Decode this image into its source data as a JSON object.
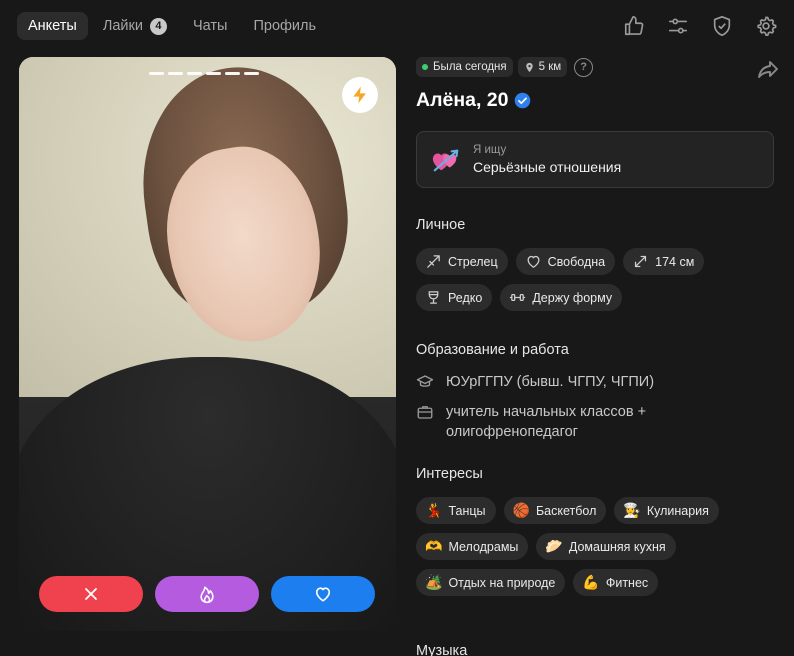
{
  "nav": {
    "tabs": [
      {
        "label": "Анкеты",
        "active": true
      },
      {
        "label": "Лайки",
        "badge": "4"
      },
      {
        "label": "Чаты"
      },
      {
        "label": "Профиль"
      }
    ],
    "icons": [
      "thumbs-up-icon",
      "sliders-icon",
      "shield-check-icon",
      "gear-icon"
    ]
  },
  "photo": {
    "photo_count": 6,
    "action_icons": [
      "close-icon",
      "fire-icon",
      "heart-icon"
    ]
  },
  "profile": {
    "status": "Была сегодня",
    "distance": "5 км",
    "help": "?",
    "name": "Алёна, 20",
    "looking": {
      "label": "Я ищу",
      "value": "Серьёзные отношения"
    },
    "personal_title": "Личное",
    "personal": [
      {
        "icon": "sagittarius-icon",
        "label": "Стрелец"
      },
      {
        "icon": "heart-outline-icon",
        "label": "Свободна"
      },
      {
        "icon": "height-icon",
        "label": "174 см"
      },
      {
        "icon": "wine-glass-icon",
        "label": "Редко"
      },
      {
        "icon": "dumbbell-icon",
        "label": "Держу форму"
      }
    ],
    "edu_title": "Образование и работа",
    "education": "ЮУрГГПУ (бывш. ЧГПУ, ЧГПИ)",
    "work": "учитель начальных классов + олигофренопедагог",
    "interests_title": "Интересы",
    "interests": [
      {
        "emoji": "💃",
        "label": "Танцы"
      },
      {
        "emoji": "🏀",
        "label": "Баскетбол"
      },
      {
        "emoji": "👩‍🍳",
        "label": "Кулинария"
      },
      {
        "emoji": "🫶",
        "label": "Мелодрамы"
      },
      {
        "emoji": "🥟",
        "label": "Домашняя кухня"
      },
      {
        "emoji": "🏕️",
        "label": "Отдых на природе"
      },
      {
        "emoji": "💪",
        "label": "Фитнес"
      }
    ],
    "music_title": "Музыка"
  },
  "colors": {
    "dislike": "#f0414e",
    "superlike": "#b45be0",
    "like": "#1d7ef0",
    "online": "#3ccf6e"
  }
}
